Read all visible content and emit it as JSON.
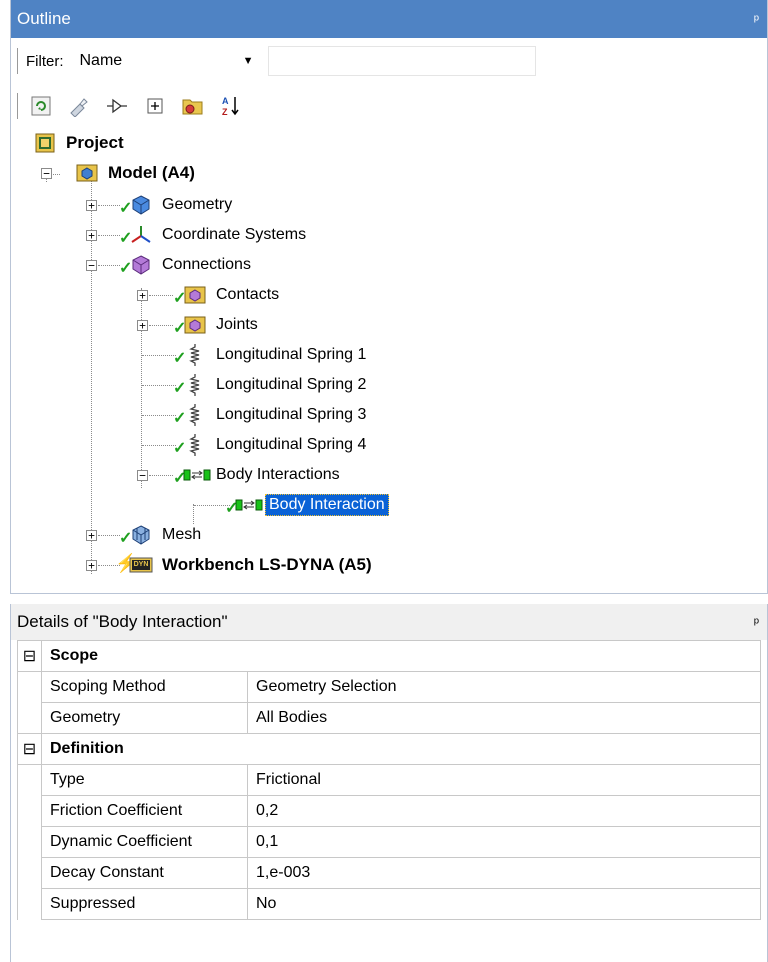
{
  "outline": {
    "title": "Outline",
    "pin": "ᵖ",
    "filter_label": "Filter:",
    "filter_value": "Name",
    "filter_text": ""
  },
  "toolbar": {
    "icons": [
      "refresh-icon",
      "wand-icon",
      "expand-arrow-icon",
      "expand-all-icon",
      "folder-icon",
      "sort-az-icon"
    ],
    "sort_glyph": "A↓Z"
  },
  "tree": {
    "project": "Project",
    "model": "Model (A4)",
    "geometry": "Geometry",
    "coordinate_systems": "Coordinate Systems",
    "connections": "Connections",
    "contacts": "Contacts",
    "joints": "Joints",
    "spring1": "Longitudinal Spring 1",
    "spring2": "Longitudinal Spring 2",
    "spring3": "Longitudinal Spring 3",
    "spring4": "Longitudinal Spring 4",
    "body_interactions": "Body Interactions",
    "body_interaction": "Body Interaction",
    "mesh": "Mesh",
    "lsdyna": "Workbench LS-DYNA (A5)",
    "lsdyna_badge": "DYN"
  },
  "details": {
    "title": "Details of \"Body Interaction\"",
    "pin": "ᵖ",
    "sections": [
      {
        "name": "Scope",
        "rows": [
          {
            "label": "Scoping Method",
            "value": "Geometry Selection"
          },
          {
            "label": "Geometry",
            "value": "All Bodies"
          }
        ]
      },
      {
        "name": "Definition",
        "rows": [
          {
            "label": "Type",
            "value": "Frictional"
          },
          {
            "label": "Friction Coefficient",
            "value": "0,2"
          },
          {
            "label": "Dynamic Coefficient",
            "value": "0,1"
          },
          {
            "label": "Decay Constant",
            "value": "1,e-003"
          },
          {
            "label": "Suppressed",
            "value": "No"
          }
        ]
      }
    ]
  },
  "colors": {
    "title_bar": "#4f83c4",
    "selection": "#0a62d6",
    "check": "#1fa01f"
  }
}
